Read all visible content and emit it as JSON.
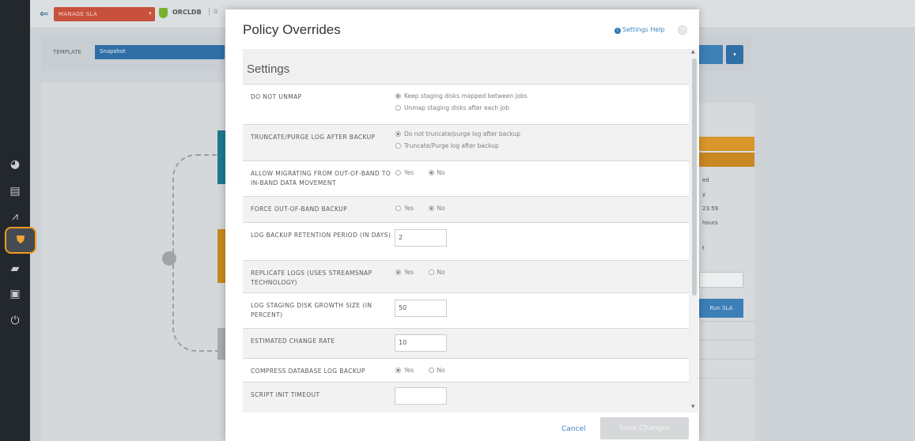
{
  "sidebar": {
    "icons": [
      "dashboard-icon",
      "database-icon",
      "analytics-icon",
      "shield-icon",
      "book-icon",
      "monitor-icon",
      "power-icon"
    ],
    "active_index": 3
  },
  "topbar": {
    "manage_sla": "MANAGE SLA",
    "database_name": "ORCLDB",
    "separator": "| a"
  },
  "template": {
    "label": "TEMPLATE",
    "value": "Snapshot"
  },
  "right_panel": {
    "texts": [
      "ed",
      "y",
      "23:59",
      "hours",
      "t"
    ],
    "run_button": "Run SLA"
  },
  "modal": {
    "title": "Policy Overrides",
    "help": "Settings Help",
    "section_title": "Settings",
    "cancel": "Cancel",
    "save": "Save Changes",
    "rows": [
      {
        "label": "DO NOT UNMAP",
        "options": [
          "Keep staging disks mapped between jobs",
          "Unmap staging disks after each job"
        ],
        "selected": 0
      },
      {
        "label": "TRUNCATE/PURGE LOG AFTER BACKUP",
        "options": [
          "Do not truncate/purge log after backup",
          "Truncate/Purge log after backup"
        ],
        "selected": 0
      },
      {
        "label": "ALLOW MIGRATING FROM OUT-OF-BAND TO IN-BAND DATA MOVEMENT",
        "options": [
          "Yes",
          "No"
        ],
        "selected": 1
      },
      {
        "label": "FORCE OUT-OF-BAND BACKUP",
        "options": [
          "Yes",
          "No"
        ],
        "selected": 1
      },
      {
        "label": "LOG BACKUP RETENTION PERIOD (IN DAYS)",
        "value": "2"
      },
      {
        "label": "REPLICATE LOGS (USES STREAMSNAP TECHNOLOGY)",
        "options": [
          "Yes",
          "No"
        ],
        "selected": 0
      },
      {
        "label": "LOG STAGING DISK GROWTH SIZE (IN PERCENT)",
        "value": "50"
      },
      {
        "label": "ESTIMATED CHANGE RATE",
        "value": "10"
      },
      {
        "label": "COMPRESS DATABASE LOG BACKUP",
        "options": [
          "Yes",
          "No"
        ],
        "selected": 0
      },
      {
        "label": "SCRIPT INIT TIMEOUT",
        "value": ""
      }
    ]
  }
}
